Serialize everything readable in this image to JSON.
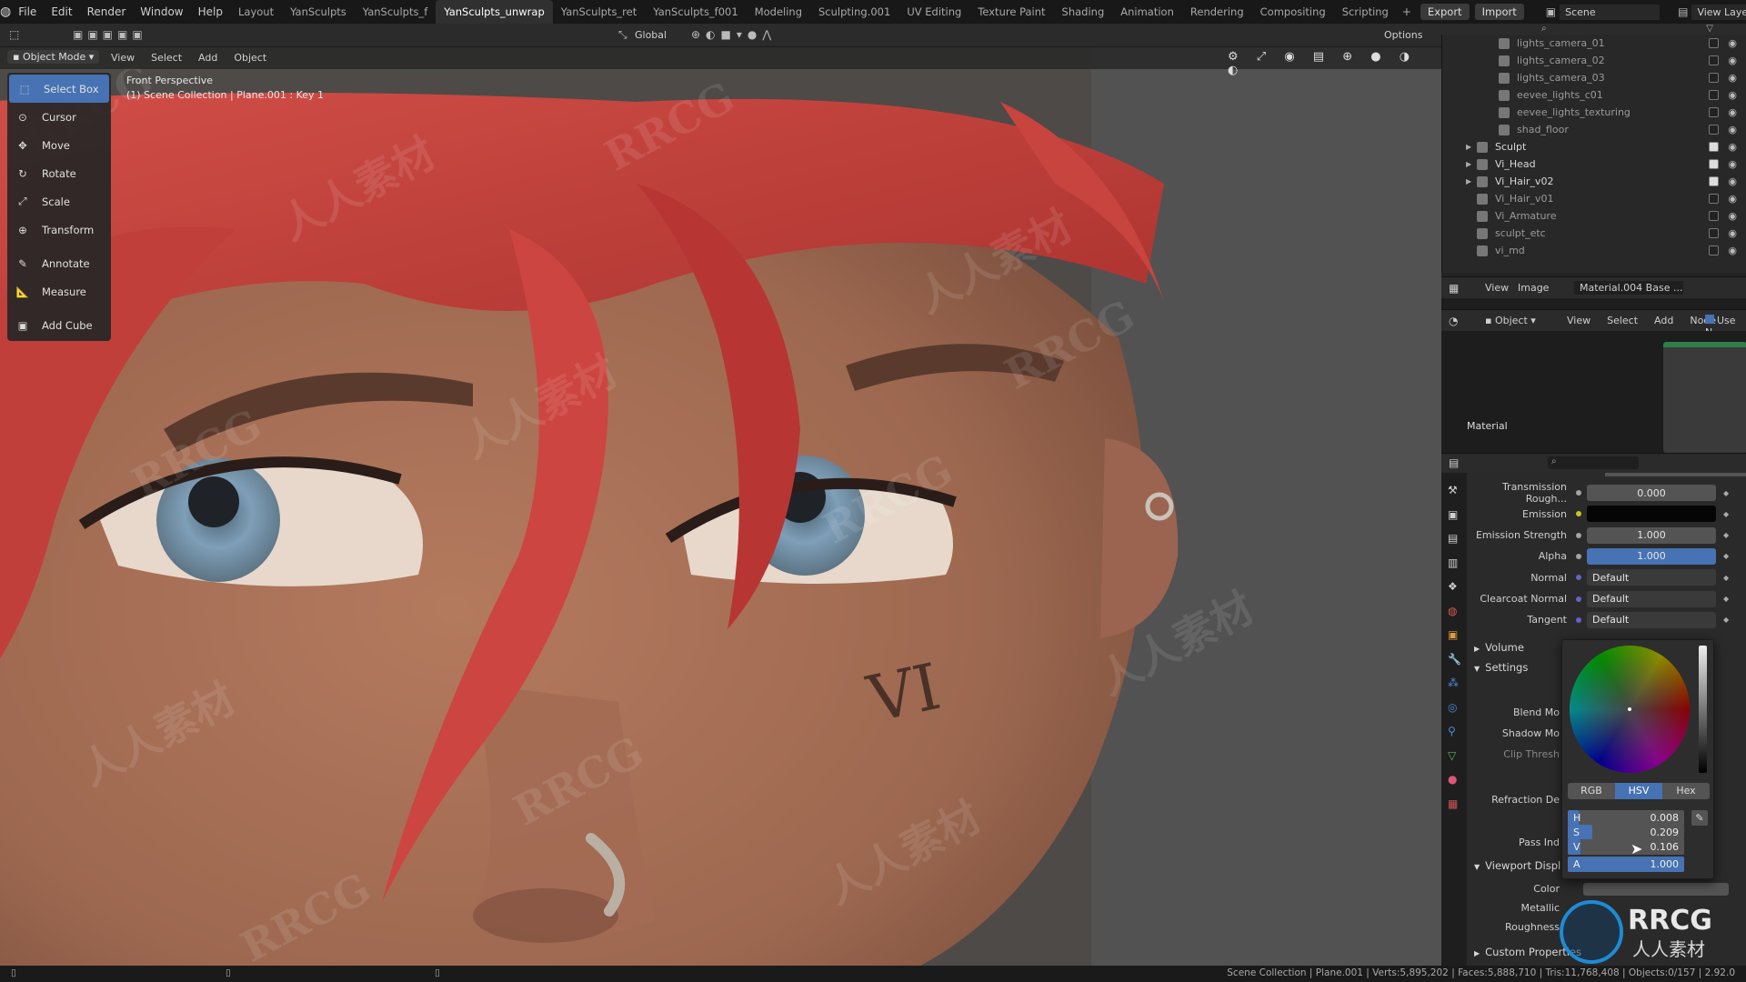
{
  "menu": [
    "File",
    "Edit",
    "Render",
    "Window",
    "Help"
  ],
  "workspaces": [
    "Layout",
    "YanSculpts",
    "YanSculpts_f",
    "YanSculpts_unwrap",
    "YanSculpts_ret",
    "YanSculpts_f001",
    "Modeling",
    "Sculpting.001",
    "UV Editing",
    "Texture Paint",
    "Shading",
    "Animation",
    "Rendering",
    "Compositing",
    "Scripting"
  ],
  "active_workspace_index": 3,
  "top_right": {
    "export": "Export",
    "import": "Import",
    "scene": "Scene",
    "view_layer": "View Layer"
  },
  "viewport_header": {
    "mode": "Object Mode",
    "menus": [
      "View",
      "Select",
      "Add",
      "Object"
    ],
    "orientation": "Global",
    "options": "Options"
  },
  "viewport_overlay": {
    "perspective": "Front Perspective",
    "collection_info": "(1) Scene Collection | Plane.001 : Key 1"
  },
  "tools": [
    {
      "label": "Select Box",
      "icon": "select-box-icon",
      "active": true
    },
    {
      "label": "Cursor",
      "icon": "cursor-icon"
    },
    {
      "label": "Move",
      "icon": "move-icon"
    },
    {
      "label": "Rotate",
      "icon": "rotate-icon"
    },
    {
      "label": "Scale",
      "icon": "scale-icon"
    },
    {
      "label": "Transform",
      "icon": "transform-icon"
    },
    {
      "label": "Annotate",
      "icon": "annotate-icon"
    },
    {
      "label": "Measure",
      "icon": "measure-icon"
    },
    {
      "label": "Add Cube",
      "icon": "add-cube-icon"
    }
  ],
  "outliner": [
    {
      "name": "lights_camera_01",
      "indent": 2,
      "checked": false
    },
    {
      "name": "lights_camera_02",
      "indent": 2,
      "checked": false
    },
    {
      "name": "lights_camera_03",
      "indent": 2,
      "checked": false
    },
    {
      "name": "eevee_lights_c01",
      "indent": 2,
      "checked": false
    },
    {
      "name": "eevee_lights_texturing",
      "indent": 2,
      "checked": false
    },
    {
      "name": "shad_floor",
      "indent": 2,
      "checked": false
    },
    {
      "name": "Sculpt",
      "indent": 1,
      "checked": true,
      "expandable": true
    },
    {
      "name": "Vi_Head",
      "indent": 1,
      "checked": true,
      "expandable": true
    },
    {
      "name": "Vi_Hair_v02",
      "indent": 1,
      "checked": true,
      "expandable": true
    },
    {
      "name": "Vi_Hair_v01",
      "indent": 1,
      "checked": false
    },
    {
      "name": "Vi_Armature",
      "indent": 1,
      "checked": false
    },
    {
      "name": "sculpt_etc",
      "indent": 1,
      "checked": false
    },
    {
      "name": "vi_md",
      "indent": 1,
      "checked": false
    }
  ],
  "image_editor": {
    "menus": [
      "View",
      "Image"
    ],
    "image_name": "Material.004 Base ..."
  },
  "node_editor": {
    "object": "Object",
    "menus": [
      "View",
      "Select",
      "Add",
      "Node"
    ],
    "use_nodes": "Use N",
    "material_label": "Material"
  },
  "properties": [
    {
      "label": "Transmission Rough...",
      "value": "0.000",
      "style": "num"
    },
    {
      "label": "Emission",
      "value": "",
      "style": "black",
      "dot": "#c7c71f"
    },
    {
      "label": "Emission Strength",
      "value": "1.000",
      "style": "num"
    },
    {
      "label": "Alpha",
      "value": "1.000",
      "style": "blue"
    },
    {
      "label": "Normal",
      "value": "Default",
      "style": "left",
      "dot": "#6363c7"
    },
    {
      "label": "Clearcoat Normal",
      "value": "Default",
      "style": "left",
      "dot": "#6363c7"
    },
    {
      "label": "Tangent",
      "value": "Default",
      "style": "left",
      "dot": "#6363c7"
    }
  ],
  "sections": {
    "volume": "Volume",
    "settings": "Settings",
    "viewport_display": "Viewport Displa",
    "custom_props": "Custom Properties"
  },
  "settings_rows": [
    "Blend Mo",
    "Shadow Mo",
    "Clip Thresh",
    "Refraction De",
    "Pass Ind"
  ],
  "viewport_rows": [
    "Color",
    "Metallic",
    "Roughness"
  ],
  "color_picker": {
    "modes": [
      "RGB",
      "HSV",
      "Hex"
    ],
    "active_mode": "HSV",
    "fields": [
      {
        "label": "H",
        "value": "0.008",
        "fill": 0.008
      },
      {
        "label": "S",
        "value": "0.209",
        "fill": 0.209
      },
      {
        "label": "V",
        "value": "0.106",
        "fill": 0.106
      },
      {
        "label": "A",
        "value": "1.000",
        "fill": 1.0
      }
    ]
  },
  "statusbar": {
    "text": "Scene Collection | Plane.001 | Verts:5,895,202 | Faces:5,888,710 | Tris:11,768,408 | Objects:0/157 | 2.92.0"
  },
  "watermarks": [
    "RRCG",
    "人人素材"
  ],
  "colors": {
    "accent": "#4772b3",
    "hair": "#c8443f",
    "skin": "#a9735a",
    "iris": "#7f9fb8"
  }
}
